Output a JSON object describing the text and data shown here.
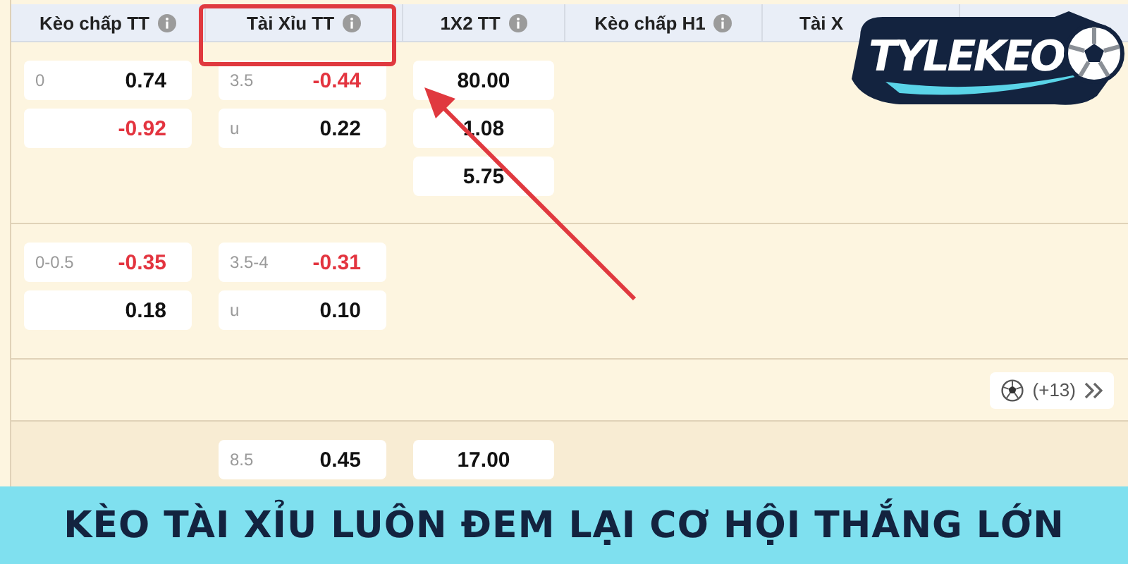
{
  "table": {
    "columns": [
      {
        "label": "Kèo chấp TT",
        "info": true
      },
      {
        "label": "Tài Xỉu TT",
        "info": true,
        "highlighted": true
      },
      {
        "label": "1X2 TT",
        "info": true
      },
      {
        "label": "Kèo chấp H1",
        "info": true
      },
      {
        "label": "Tài X"
      }
    ],
    "rows": [
      {
        "kind": "match",
        "handicap": [
          {
            "line": "0",
            "odds": "0.74",
            "negative": false
          },
          {
            "odds": "-0.92",
            "negative": true
          }
        ],
        "total": [
          {
            "line": "3.5",
            "odds": "-0.44",
            "negative": true
          },
          {
            "line": "u",
            "odds": "0.22",
            "negative": false
          }
        ],
        "result": [
          "80.00",
          "1.08",
          "5.75"
        ]
      },
      {
        "kind": "match",
        "handicap": [
          {
            "line": "0-0.5",
            "odds": "-0.35",
            "negative": true
          },
          {
            "odds": "0.18",
            "negative": false
          }
        ],
        "total": [
          {
            "line": "3.5-4",
            "odds": "-0.31",
            "negative": true
          },
          {
            "line": "u",
            "odds": "0.10",
            "negative": false
          }
        ],
        "result": []
      },
      {
        "kind": "more",
        "count": "(+13)"
      },
      {
        "kind": "match",
        "handicap": [],
        "total": [
          {
            "line": "8.5",
            "odds": "0.45",
            "negative": false
          }
        ],
        "result": [
          "17.00"
        ]
      }
    ]
  },
  "logo": {
    "text": "TYLEKEO"
  },
  "banner": {
    "title": "KÈO TÀI XỈU LUÔN ĐEM LẠI CƠ HỘI THẮNG LỚN"
  }
}
